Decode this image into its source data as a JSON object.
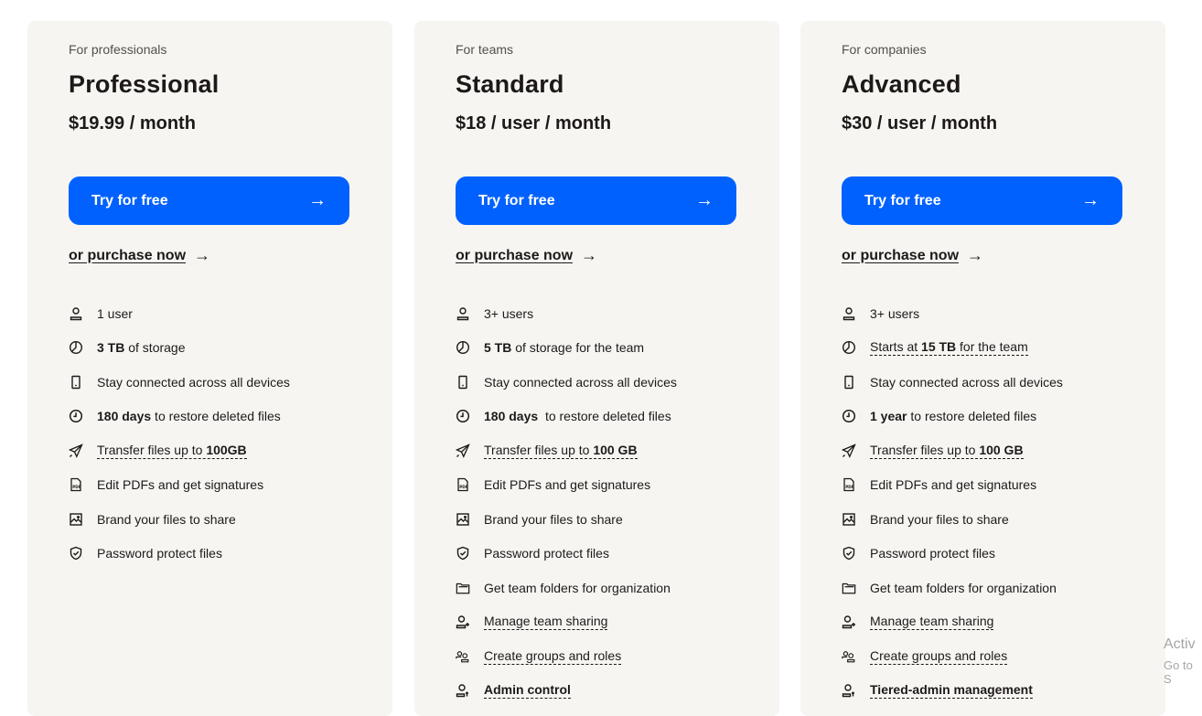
{
  "plans": [
    {
      "eyebrow": "For professionals",
      "name": "Professional",
      "price": "$19.99 / month",
      "cta": "Try for free",
      "purchase": "or purchase now",
      "features": [
        {
          "icon": "user-icon",
          "parts": [
            {
              "t": "1 user"
            }
          ]
        },
        {
          "icon": "storage-icon",
          "parts": [
            {
              "t": "3 TB",
              "b": true
            },
            {
              "t": " of storage"
            }
          ]
        },
        {
          "icon": "device-icon",
          "parts": [
            {
              "t": "Stay connected across all devices"
            }
          ]
        },
        {
          "icon": "clock-icon",
          "parts": [
            {
              "t": "180 days",
              "b": true
            },
            {
              "t": " to restore deleted files"
            }
          ]
        },
        {
          "icon": "send-icon",
          "dotted": true,
          "parts": [
            {
              "t": "Transfer files up to "
            },
            {
              "t": "100GB",
              "b": true
            }
          ]
        },
        {
          "icon": "pdf-icon",
          "parts": [
            {
              "t": "Edit PDFs and get signatures"
            }
          ]
        },
        {
          "icon": "image-icon",
          "parts": [
            {
              "t": "Brand your files to share"
            }
          ]
        },
        {
          "icon": "shield-icon",
          "parts": [
            {
              "t": "Password protect files"
            }
          ]
        }
      ]
    },
    {
      "eyebrow": "For teams",
      "name": "Standard",
      "price": "$18 / user / month",
      "cta": "Try for free",
      "purchase": "or purchase now",
      "features": [
        {
          "icon": "user-icon",
          "parts": [
            {
              "t": "3+ users"
            }
          ]
        },
        {
          "icon": "storage-icon",
          "parts": [
            {
              "t": "5 TB",
              "b": true
            },
            {
              "t": " of storage for the team"
            }
          ]
        },
        {
          "icon": "device-icon",
          "parts": [
            {
              "t": "Stay connected across all devices"
            }
          ]
        },
        {
          "icon": "clock-icon",
          "parts": [
            {
              "t": "180 days",
              "b": true
            },
            {
              "t": "  to restore deleted files"
            }
          ]
        },
        {
          "icon": "send-icon",
          "dotted": true,
          "parts": [
            {
              "t": "Transfer files up to "
            },
            {
              "t": "100 GB",
              "b": true
            }
          ]
        },
        {
          "icon": "pdf-icon",
          "parts": [
            {
              "t": "Edit PDFs and get signatures"
            }
          ]
        },
        {
          "icon": "image-icon",
          "parts": [
            {
              "t": "Brand your files to share"
            }
          ]
        },
        {
          "icon": "shield-icon",
          "parts": [
            {
              "t": "Password protect files"
            }
          ]
        },
        {
          "icon": "folder-icon",
          "parts": [
            {
              "t": "Get team folders for organization"
            }
          ]
        },
        {
          "icon": "user-add-icon",
          "dotted": true,
          "parts": [
            {
              "t": "Manage team sharing"
            }
          ]
        },
        {
          "icon": "group-icon",
          "dotted": true,
          "parts": [
            {
              "t": "Create groups and roles"
            }
          ]
        },
        {
          "icon": "admin-icon",
          "dotted": true,
          "parts": [
            {
              "t": "Admin control",
              "b": true
            }
          ]
        }
      ]
    },
    {
      "eyebrow": "For companies",
      "name": "Advanced",
      "price": "$30 / user / month",
      "cta": "Try for free",
      "purchase": "or purchase now",
      "features": [
        {
          "icon": "user-icon",
          "parts": [
            {
              "t": "3+ users"
            }
          ]
        },
        {
          "icon": "storage-icon",
          "dotted": true,
          "parts": [
            {
              "t": "Starts at "
            },
            {
              "t": "15 TB",
              "b": true
            },
            {
              "t": " for the team"
            }
          ]
        },
        {
          "icon": "device-icon",
          "parts": [
            {
              "t": "Stay connected across all devices"
            }
          ]
        },
        {
          "icon": "clock-icon",
          "parts": [
            {
              "t": "1 year",
              "b": true
            },
            {
              "t": " to restore deleted files"
            }
          ]
        },
        {
          "icon": "send-icon",
          "dotted": true,
          "parts": [
            {
              "t": "Transfer files up to "
            },
            {
              "t": "100 GB",
              "b": true
            }
          ]
        },
        {
          "icon": "pdf-icon",
          "parts": [
            {
              "t": "Edit PDFs and get signatures"
            }
          ]
        },
        {
          "icon": "image-icon",
          "parts": [
            {
              "t": "Brand your files to share"
            }
          ]
        },
        {
          "icon": "shield-icon",
          "parts": [
            {
              "t": "Password protect files"
            }
          ]
        },
        {
          "icon": "folder-icon",
          "parts": [
            {
              "t": "Get team folders for organization"
            }
          ]
        },
        {
          "icon": "user-add-icon",
          "dotted": true,
          "parts": [
            {
              "t": "Manage team sharing"
            }
          ]
        },
        {
          "icon": "group-icon",
          "dotted": true,
          "parts": [
            {
              "t": "Create groups and roles"
            }
          ]
        },
        {
          "icon": "admin-icon",
          "dotted": true,
          "parts": [
            {
              "t": "Tiered-admin management",
              "b": true
            }
          ]
        }
      ]
    }
  ],
  "watermark": {
    "line1": "Activ",
    "line2": "Go to S"
  },
  "colors": {
    "accent": "#0061fe",
    "card_bg": "#f7f5f2",
    "text": "#1e1919"
  }
}
